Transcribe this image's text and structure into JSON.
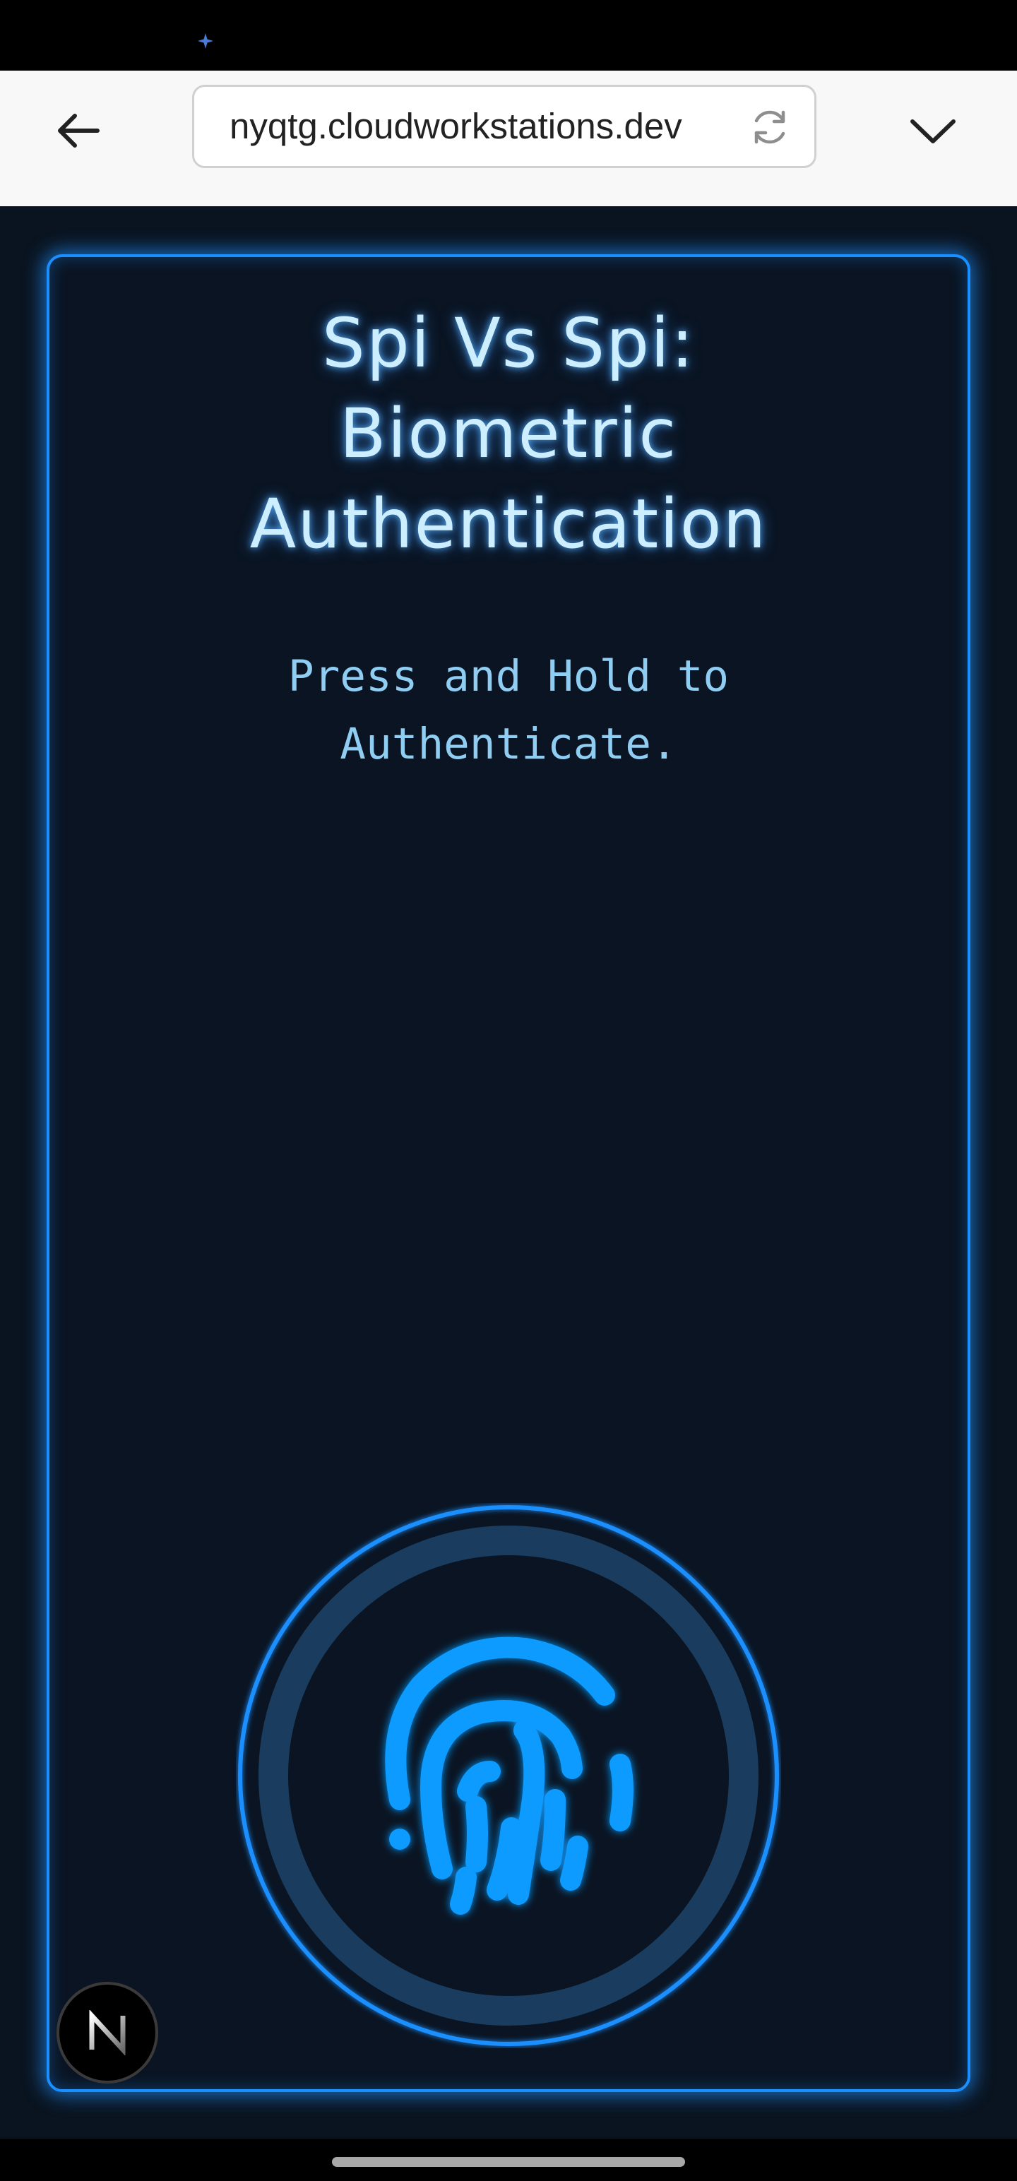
{
  "status_bar": {
    "indicator_icon": "sparkle-icon",
    "indicator_color": "#4a7bd8"
  },
  "browser": {
    "back_icon": "arrow-left-icon",
    "url": "nyqtg.cloudworkstations.dev",
    "reload_icon": "reload-icon",
    "menu_icon": "chevron-down-icon"
  },
  "auth_card": {
    "title_lines": [
      "Spi Vs Spi:",
      "Biometric",
      "Authentication"
    ],
    "instruction_lines": [
      "Press and Hold to",
      "Authenticate."
    ],
    "scanner_icon": "fingerprint-icon",
    "colors": {
      "accent": "#1a8fff",
      "fingerprint": "#0a9bff",
      "ring_track": "#1a3c5e",
      "title": "#cdeeff",
      "instruction": "#8fcdf2",
      "background": "#0a1422"
    }
  },
  "dev_badge": {
    "letter": "N"
  }
}
